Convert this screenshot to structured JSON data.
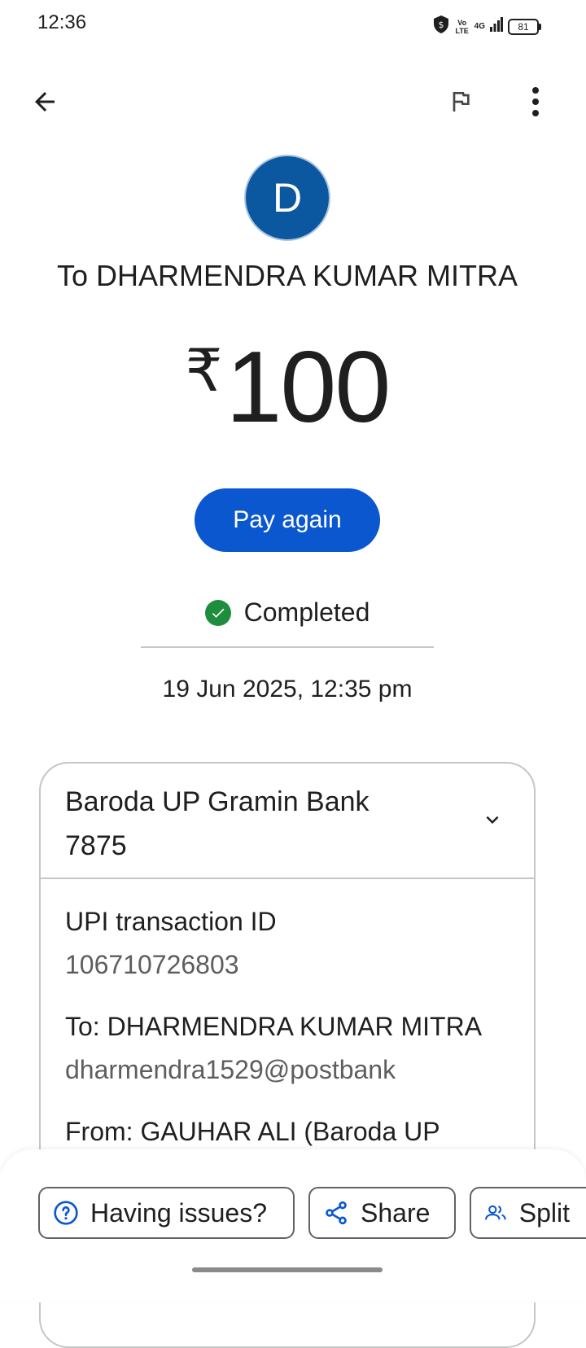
{
  "status_bar": {
    "time": "12:36",
    "battery": "81",
    "volte": "Vo LTE",
    "network": "4G"
  },
  "topbar": {
    "back_icon": "arrow-left-icon",
    "flag_icon": "flag-icon",
    "menu_icon": "more-vert-icon"
  },
  "recipient": {
    "initial": "D",
    "title": "To DHARMENDRA KUMAR MITRA"
  },
  "amount": {
    "currency": "₹",
    "value": "100"
  },
  "actions": {
    "pay_again": "Pay again"
  },
  "status": {
    "text": "Completed",
    "color": "#1e8e3e"
  },
  "datetime": "19 Jun 2025, 12:35 pm",
  "details": {
    "bank_name": "Baroda UP Gramin Bank",
    "account_suffix": "7875",
    "upi_label": "UPI transaction ID",
    "upi_value": "106710726803",
    "to_label": "To: DHARMENDRA KUMAR MITRA",
    "to_value": "dharmendra1529@postbank",
    "from_label": "From: GAUHAR ALI (Baroda UP"
  },
  "bottom_actions": {
    "issues": "Having issues?",
    "share": "Share",
    "split": "Split"
  },
  "colors": {
    "accent": "#0b57d0",
    "avatar": "#0b57a0"
  }
}
